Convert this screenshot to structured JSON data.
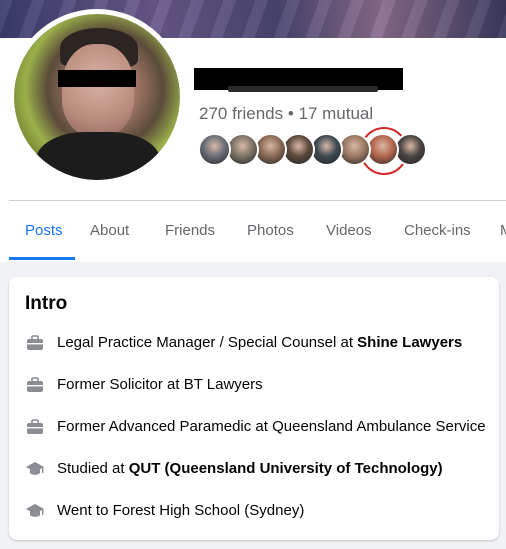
{
  "profile": {
    "friends_line": "270 friends • 17 mutual"
  },
  "mutual_friends": {
    "count_shown": 8,
    "colors": [
      "#6b6f78",
      "#7c7466",
      "#8a6a55",
      "#5b4a3c",
      "#3e4a52",
      "#9b7a63",
      "#b5674e",
      "#4a4442"
    ]
  },
  "tabs": [
    {
      "label": "Posts",
      "active": true
    },
    {
      "label": "About",
      "active": false
    },
    {
      "label": "Friends",
      "active": false
    },
    {
      "label": "Photos",
      "active": false
    },
    {
      "label": "Videos",
      "active": false
    },
    {
      "label": "Check-ins",
      "active": false
    },
    {
      "label": "M",
      "active": false
    }
  ],
  "intro": {
    "title": "Intro",
    "items": [
      {
        "icon": "briefcase-icon",
        "text": "Legal Practice Manager / Special Counsel at ",
        "bold": "Shine Lawyers"
      },
      {
        "icon": "briefcase-icon",
        "text": "Former Solicitor at BT Lawyers",
        "bold": ""
      },
      {
        "icon": "briefcase-icon",
        "text": "Former Advanced Paramedic at Queensland Ambulance Service",
        "bold": ""
      },
      {
        "icon": "graduation-cap-icon",
        "text": "Studied at ",
        "bold": "QUT (Queensland University of Technology)"
      },
      {
        "icon": "graduation-cap-icon",
        "text": "Went to Forest High School (Sydney)",
        "bold": ""
      }
    ]
  },
  "colors": {
    "accent": "#1877f2",
    "secondary_text": "#65676b",
    "highlight_circle": "#d32a2a"
  }
}
